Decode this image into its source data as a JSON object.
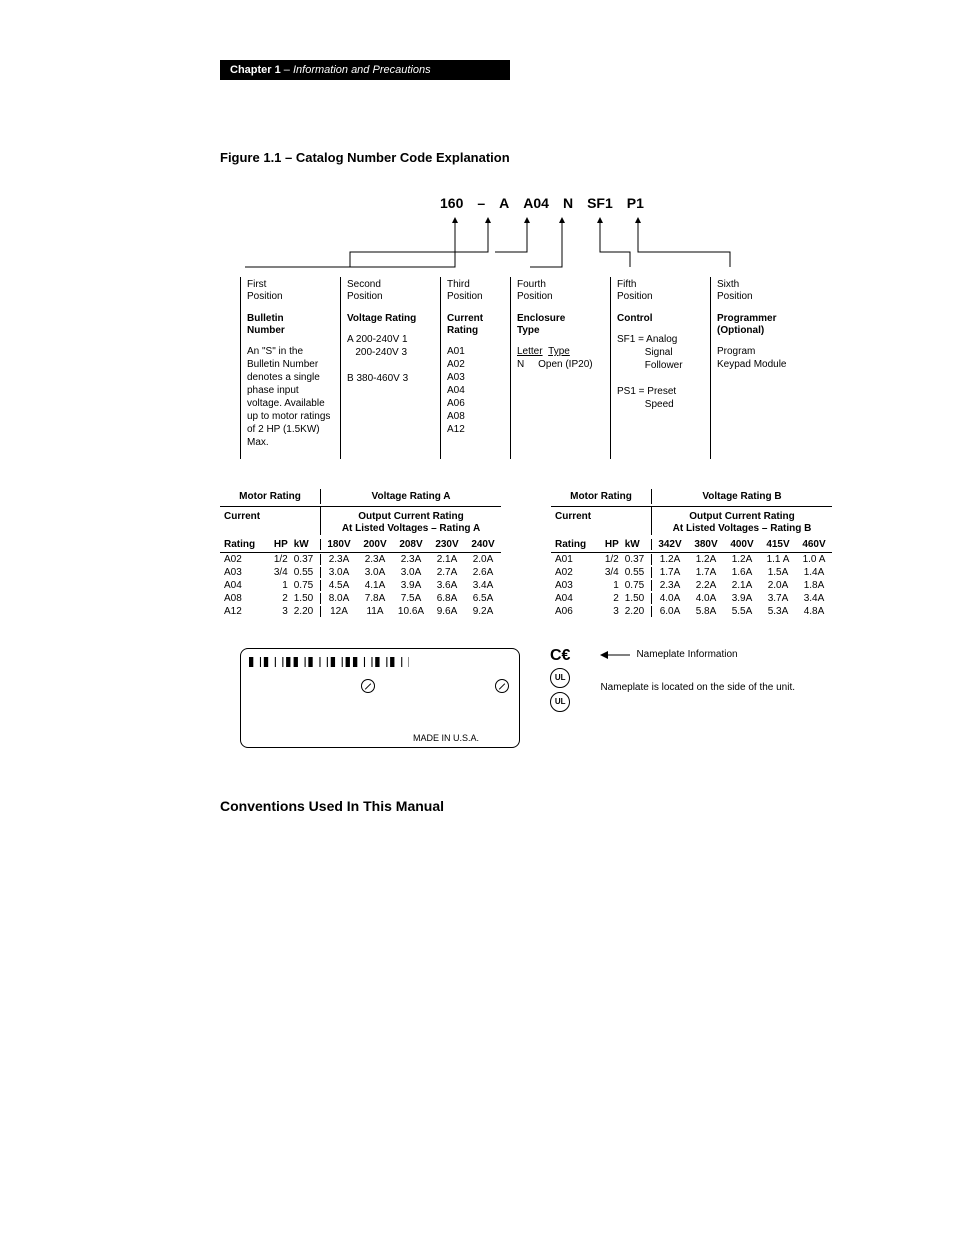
{
  "header": {
    "chapter": "Chapter 1",
    "sep": " – ",
    "title": "Information and Precautions"
  },
  "figure_title": "Figure 1.1 – Catalog Number Code Explanation",
  "code": {
    "p1": "160",
    "dash": "–",
    "p2": "A",
    "p3": "A04",
    "p4": "N",
    "p5": "SF1",
    "p6": "P1"
  },
  "positions": {
    "first": {
      "label": "First\nPosition",
      "heading": "Bulletin\nNumber",
      "body": "An \"S\" in the Bulletin Number denotes a single phase input voltage. Available up to motor ratings of 2 HP (1.5KW) Max."
    },
    "second": {
      "label": "Second\nPosition",
      "heading": "Voltage Rating",
      "body_lines": [
        "A 200-240V 1",
        "   200-240V 3",
        "",
        "B 380-460V 3"
      ]
    },
    "third": {
      "label": "Third\nPosition",
      "heading": "Current\nRating",
      "body_lines": [
        "A01",
        "A02",
        "A03",
        "A04",
        "A06",
        "A08",
        "A12"
      ]
    },
    "fourth": {
      "label": "Fourth\nPosition",
      "heading": "Enclosure\nType",
      "body_head_letter": "Letter",
      "body_head_type": "Type",
      "body_rows": [
        [
          "N",
          "Open (IP20)"
        ]
      ]
    },
    "fifth": {
      "label": "Fifth\nPosition",
      "heading": "Control",
      "body_lines": [
        "SF1 = Analog",
        "          Signal",
        "          Follower",
        "",
        "PS1 = Preset",
        "          Speed"
      ]
    },
    "sixth": {
      "label": "Sixth\nPosition",
      "heading": "Programmer\n(Optional)",
      "body_lines": [
        "Program",
        "Keypad Module"
      ]
    }
  },
  "ratingA": {
    "motor_head": "Motor Rating",
    "volt_head": "Voltage Rating A",
    "ocr_line1": "Output Current Rating",
    "ocr_line2": "At Listed Voltages – Rating A",
    "left_head": {
      "current": "Current",
      "rating": "Rating",
      "hp": "HP",
      "kw": "kW"
    },
    "v_cols": [
      "180V",
      "200V",
      "208V",
      "230V",
      "240V"
    ],
    "rows": [
      {
        "code": "A02",
        "hp": "1/2",
        "kw": "0.37",
        "v": [
          "2.3A",
          "2.3A",
          "2.3A",
          "2.1A",
          "2.0A"
        ]
      },
      {
        "code": "A03",
        "hp": "3/4",
        "kw": "0.55",
        "v": [
          "3.0A",
          "3.0A",
          "3.0A",
          "2.7A",
          "2.6A"
        ]
      },
      {
        "code": "A04",
        "hp": "1",
        "kw": "0.75",
        "v": [
          "4.5A",
          "4.1A",
          "3.9A",
          "3.6A",
          "3.4A"
        ]
      },
      {
        "code": "A08",
        "hp": "2",
        "kw": "1.50",
        "v": [
          "8.0A",
          "7.8A",
          "7.5A",
          "6.8A",
          "6.5A"
        ]
      },
      {
        "code": "A12",
        "hp": "3",
        "kw": "2.20",
        "v": [
          "12A",
          "11A",
          "10.6A",
          "9.6A",
          "9.2A"
        ]
      }
    ]
  },
  "ratingB": {
    "motor_head": "Motor Rating",
    "volt_head": "Voltage Rating B",
    "ocr_line1": "Output Current Rating",
    "ocr_line2": "At Listed Voltages – Rating B",
    "left_head": {
      "current": "Current",
      "rating": "Rating",
      "hp": "HP",
      "kw": "kW"
    },
    "v_cols": [
      "342V",
      "380V",
      "400V",
      "415V",
      "460V"
    ],
    "rows": [
      {
        "code": "A01",
        "hp": "1/2",
        "kw": "0.37",
        "v": [
          "1.2A",
          "1.2A",
          "1.2A",
          "1.1 A",
          "1.0 A"
        ]
      },
      {
        "code": "A02",
        "hp": "3/4",
        "kw": "0.55",
        "v": [
          "1.7A",
          "1.7A",
          "1.6A",
          "1.5A",
          "1.4A"
        ]
      },
      {
        "code": "A03",
        "hp": "1",
        "kw": "0.75",
        "v": [
          "2.3A",
          "2.2A",
          "2.1A",
          "2.0A",
          "1.8A"
        ]
      },
      {
        "code": "A04",
        "hp": "2",
        "kw": "1.50",
        "v": [
          "4.0A",
          "4.0A",
          "3.9A",
          "3.7A",
          "3.4A"
        ]
      },
      {
        "code": "A06",
        "hp": "3",
        "kw": "2.20",
        "v": [
          "6.0A",
          "5.8A",
          "5.5A",
          "5.3A",
          "4.8A"
        ]
      }
    ]
  },
  "nameplate": {
    "made_in": "MADE IN U.S.A.",
    "info_label": "Nameplate Information",
    "info_body": "Nameplate is located on the side of the unit.",
    "ce": "CE",
    "ul": "UL"
  },
  "conventions_heading": "Conventions Used In This Manual"
}
